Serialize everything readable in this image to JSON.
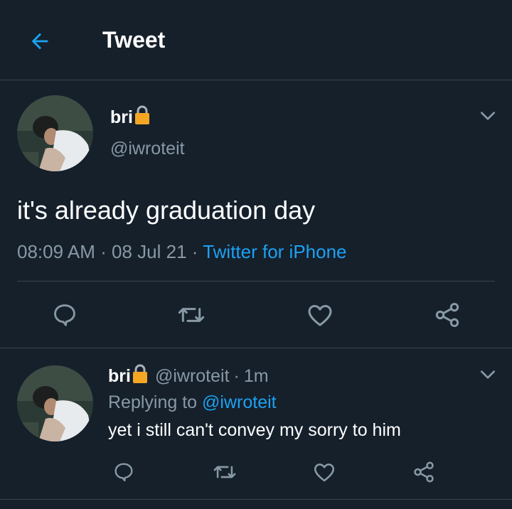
{
  "header": {
    "title": "Tweet",
    "back_icon": "arrow-left-icon"
  },
  "colors": {
    "background": "#15202b",
    "accent": "#1da1f2",
    "muted": "#8899a6",
    "divider": "#38444d",
    "lock": "#f5a623"
  },
  "tweet": {
    "display_name": "bri",
    "lock_icon": "lock-icon",
    "handle": "@iwroteit",
    "text": "it's already graduation day",
    "time": "08:09 AM",
    "sep1": "·",
    "date": "08 Jul 21",
    "sep2": "·",
    "source": "Twitter for iPhone",
    "actions": [
      "reply-icon",
      "retweet-icon",
      "like-icon",
      "share-icon"
    ]
  },
  "reply": {
    "display_name": "bri",
    "handle": "@iwroteit",
    "sep": "·",
    "time_ago": "1m",
    "replying_prefix": "Replying to",
    "replying_to": "@iwroteit",
    "text": "yet i still can't convey my sorry to him",
    "actions": [
      "reply-icon",
      "retweet-icon",
      "like-icon",
      "share-icon"
    ]
  }
}
